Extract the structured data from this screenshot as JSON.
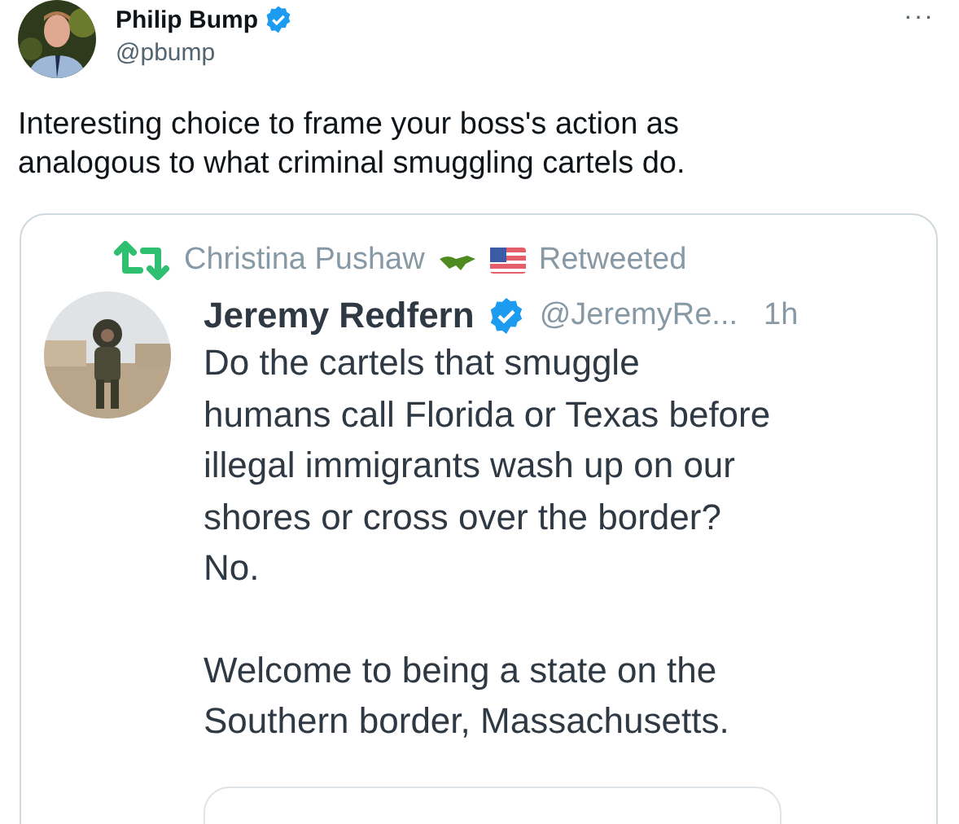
{
  "tweet": {
    "author": {
      "name": "Philip Bump",
      "handle": "@pbump",
      "verified": true
    },
    "more": "···",
    "text": "Interesting choice to frame your boss's action as analogous to what criminal smuggling cartels do."
  },
  "quoted_screenshot": {
    "retweeted_by": "Christina Pushaw",
    "retweeted_label": "Retweeted",
    "author": {
      "name": "Jeremy Redfern",
      "handle": "@JeremyRe...",
      "verified": true
    },
    "time": "1h",
    "paragraphs": [
      "Do the cartels that smuggle\nhumans call Florida or Texas before\nillegal immigrants wash up on our\nshores or cross over the border?\nNo.",
      "Welcome to being a state on the\nSouthern border, Massachusetts."
    ]
  }
}
